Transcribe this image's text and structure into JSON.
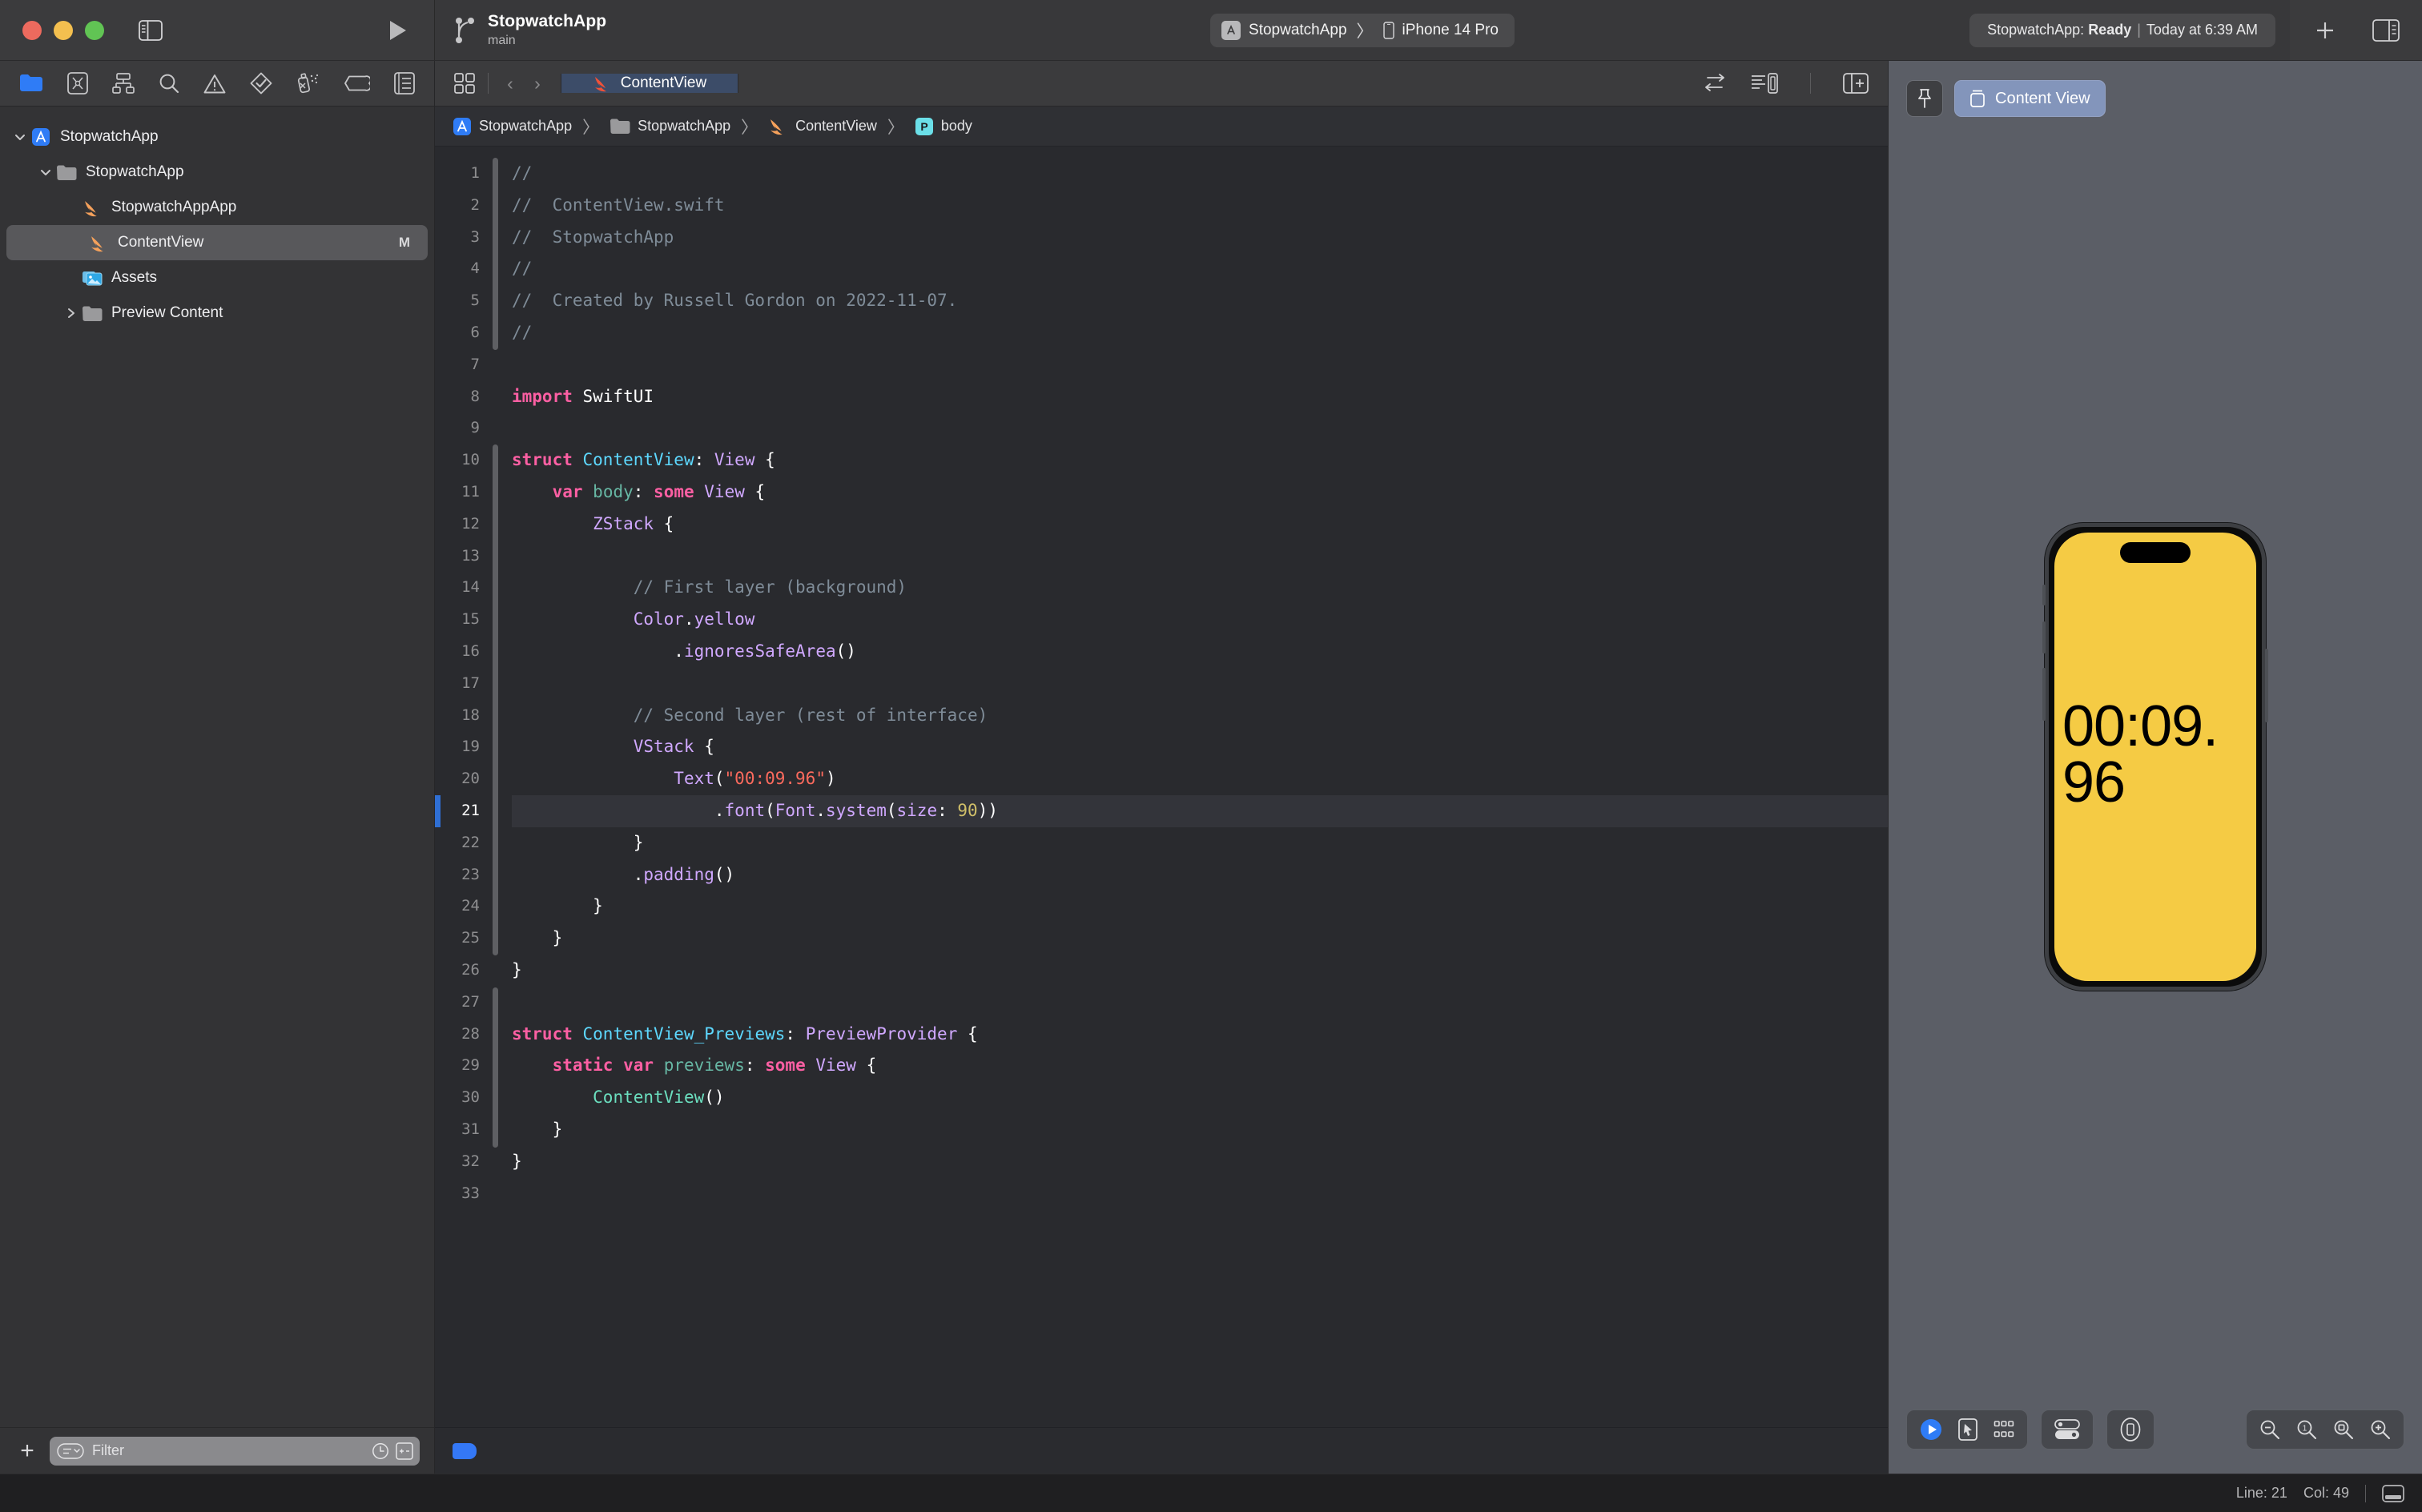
{
  "window": {
    "traffic_lights": [
      "close",
      "minimize",
      "zoom"
    ],
    "sidebar_toggle_icon": "sidebar-left-icon",
    "run_icon": "play-icon",
    "add_icon": "plus-icon",
    "inspector_toggle_icon": "sidebar-right-icon"
  },
  "project": {
    "name": "StopwatchApp",
    "branch": "main",
    "branch_icon": "git-branch-icon"
  },
  "scheme": {
    "app_icon": "appstore-icon",
    "scheme_name": "StopwatchApp",
    "separator": "〉",
    "device_icon": "iphone-icon",
    "destination": "iPhone 14 Pro"
  },
  "activity": {
    "prefix": "StopwatchApp:",
    "state": "Ready",
    "divider": "|",
    "time": "Today at 6:39 AM"
  },
  "navigator": {
    "tabs": [
      {
        "name": "project-navigator",
        "icon": "folder-icon",
        "active": true
      },
      {
        "name": "source-control-navigator",
        "icon": "source-control-icon",
        "active": false
      },
      {
        "name": "symbol-navigator",
        "icon": "hierarchy-icon",
        "active": false
      },
      {
        "name": "find-navigator",
        "icon": "search-icon",
        "active": false
      },
      {
        "name": "issue-navigator",
        "icon": "warning-triangle-icon",
        "active": false
      },
      {
        "name": "test-navigator",
        "icon": "diamond-check-icon",
        "active": false
      },
      {
        "name": "debug-navigator",
        "icon": "spray-icon",
        "active": false
      },
      {
        "name": "breakpoint-navigator",
        "icon": "tag-icon",
        "active": false
      },
      {
        "name": "report-navigator",
        "icon": "list-icon",
        "active": false
      }
    ],
    "tree": [
      {
        "label": "StopwatchApp",
        "icon": "appstore-icon",
        "depth": 0,
        "disclosure": "open",
        "selected": false,
        "badge": ""
      },
      {
        "label": "StopwatchApp",
        "icon": "folder-icon",
        "depth": 1,
        "disclosure": "open",
        "selected": false,
        "badge": ""
      },
      {
        "label": "StopwatchAppApp",
        "icon": "swift-icon",
        "depth": 2,
        "disclosure": "none",
        "selected": false,
        "badge": ""
      },
      {
        "label": "ContentView",
        "icon": "swift-icon",
        "depth": 2,
        "disclosure": "none",
        "selected": true,
        "badge": "M"
      },
      {
        "label": "Assets",
        "icon": "assets-icon",
        "depth": 2,
        "disclosure": "none",
        "selected": false,
        "badge": ""
      },
      {
        "label": "Preview Content",
        "icon": "folder-icon",
        "depth": 2,
        "disclosure": "closed",
        "selected": false,
        "badge": ""
      }
    ],
    "filter": {
      "placeholder": "Filter",
      "add_label": "+",
      "filter_icon": "filter-lines-icon",
      "recent_icon": "clock-icon",
      "source-control-icon": "plus-minus-icon"
    }
  },
  "editor": {
    "jumpbar_icon": "grid-squares-icon",
    "back_arrow": "‹",
    "forward_arrow": "›",
    "tab": {
      "label": "ContentView",
      "icon": "swift-icon"
    },
    "right_icons": [
      "adjust-editor-icon",
      "minimap-icon",
      "add-editor-icon"
    ],
    "breadcrumb": [
      {
        "label": "StopwatchApp",
        "icon": "appstore-icon"
      },
      {
        "label": "StopwatchApp",
        "icon": "folder-icon"
      },
      {
        "label": "ContentView",
        "icon": "swift-icon"
      },
      {
        "label": "body",
        "icon": "property-badge"
      }
    ],
    "breadcrumb_separator": "〉",
    "highlighted_line": 21,
    "first_line": 1,
    "last_line": 33,
    "code_lines": [
      {
        "n": 1,
        "tokens": [
          {
            "t": "//",
            "c": "cmt"
          }
        ]
      },
      {
        "n": 2,
        "tokens": [
          {
            "t": "//  ContentView.swift",
            "c": "cmt"
          }
        ]
      },
      {
        "n": 3,
        "tokens": [
          {
            "t": "//  StopwatchApp",
            "c": "cmt"
          }
        ]
      },
      {
        "n": 4,
        "tokens": [
          {
            "t": "//",
            "c": "cmt"
          }
        ]
      },
      {
        "n": 5,
        "tokens": [
          {
            "t": "//  Created by Russell Gordon on 2022-11-07.",
            "c": "cmt"
          }
        ]
      },
      {
        "n": 6,
        "tokens": [
          {
            "t": "//",
            "c": "cmt"
          }
        ]
      },
      {
        "n": 7,
        "tokens": []
      },
      {
        "n": 8,
        "tokens": [
          {
            "t": "import",
            "c": "kw"
          },
          {
            "t": " SwiftUI",
            "c": "plain"
          }
        ]
      },
      {
        "n": 9,
        "tokens": []
      },
      {
        "n": 10,
        "tokens": [
          {
            "t": "struct",
            "c": "kw"
          },
          {
            "t": " ",
            "c": "plain"
          },
          {
            "t": "ContentView",
            "c": "typ"
          },
          {
            "t": ": ",
            "c": "plain"
          },
          {
            "t": "View",
            "c": "proto"
          },
          {
            "t": " {",
            "c": "plain"
          }
        ]
      },
      {
        "n": 11,
        "tokens": [
          {
            "t": "    ",
            "c": "plain"
          },
          {
            "t": "var",
            "c": "kw"
          },
          {
            "t": " ",
            "c": "plain"
          },
          {
            "t": "body",
            "c": "prop"
          },
          {
            "t": ": ",
            "c": "plain"
          },
          {
            "t": "some",
            "c": "kw"
          },
          {
            "t": " ",
            "c": "plain"
          },
          {
            "t": "View",
            "c": "proto"
          },
          {
            "t": " {",
            "c": "plain"
          }
        ]
      },
      {
        "n": 12,
        "tokens": [
          {
            "t": "        ",
            "c": "plain"
          },
          {
            "t": "ZStack",
            "c": "proto"
          },
          {
            "t": " {",
            "c": "plain"
          }
        ]
      },
      {
        "n": 13,
        "tokens": []
      },
      {
        "n": 14,
        "tokens": [
          {
            "t": "            // First layer (background)",
            "c": "cmt"
          }
        ]
      },
      {
        "n": 15,
        "tokens": [
          {
            "t": "            ",
            "c": "plain"
          },
          {
            "t": "Color",
            "c": "proto"
          },
          {
            "t": ".",
            "c": "plain"
          },
          {
            "t": "yellow",
            "c": "meth"
          }
        ]
      },
      {
        "n": 16,
        "tokens": [
          {
            "t": "                ",
            "c": "plain"
          },
          {
            "t": ".",
            "c": "plain"
          },
          {
            "t": "ignoresSafeArea",
            "c": "meth"
          },
          {
            "t": "()",
            "c": "plain"
          }
        ]
      },
      {
        "n": 17,
        "tokens": []
      },
      {
        "n": 18,
        "tokens": [
          {
            "t": "            // Second layer (rest of interface)",
            "c": "cmt"
          }
        ]
      },
      {
        "n": 19,
        "tokens": [
          {
            "t": "            ",
            "c": "plain"
          },
          {
            "t": "VStack",
            "c": "proto"
          },
          {
            "t": " {",
            "c": "plain"
          }
        ]
      },
      {
        "n": 20,
        "tokens": [
          {
            "t": "                ",
            "c": "plain"
          },
          {
            "t": "Text",
            "c": "proto"
          },
          {
            "t": "(",
            "c": "plain"
          },
          {
            "t": "\"00:09.96\"",
            "c": "str"
          },
          {
            "t": ")",
            "c": "plain"
          }
        ]
      },
      {
        "n": 21,
        "tokens": [
          {
            "t": "                    ",
            "c": "plain"
          },
          {
            "t": ".",
            "c": "plain"
          },
          {
            "t": "font",
            "c": "meth"
          },
          {
            "t": "(",
            "c": "plain"
          },
          {
            "t": "Font",
            "c": "proto"
          },
          {
            "t": ".",
            "c": "plain"
          },
          {
            "t": "system",
            "c": "meth"
          },
          {
            "t": "(",
            "c": "plain"
          },
          {
            "t": "size",
            "c": "meth"
          },
          {
            "t": ": ",
            "c": "plain"
          },
          {
            "t": "90",
            "c": "num"
          },
          {
            "t": "))",
            "c": "plain"
          }
        ]
      },
      {
        "n": 22,
        "tokens": [
          {
            "t": "            }",
            "c": "plain"
          }
        ]
      },
      {
        "n": 23,
        "tokens": [
          {
            "t": "            ",
            "c": "plain"
          },
          {
            "t": ".",
            "c": "plain"
          },
          {
            "t": "padding",
            "c": "meth"
          },
          {
            "t": "()",
            "c": "plain"
          }
        ]
      },
      {
        "n": 24,
        "tokens": [
          {
            "t": "        }",
            "c": "plain"
          }
        ]
      },
      {
        "n": 25,
        "tokens": [
          {
            "t": "    }",
            "c": "plain"
          }
        ]
      },
      {
        "n": 26,
        "tokens": [
          {
            "t": "}",
            "c": "plain"
          }
        ]
      },
      {
        "n": 27,
        "tokens": []
      },
      {
        "n": 28,
        "tokens": [
          {
            "t": "struct",
            "c": "kw"
          },
          {
            "t": " ",
            "c": "plain"
          },
          {
            "t": "ContentView_Previews",
            "c": "typ"
          },
          {
            "t": ": ",
            "c": "plain"
          },
          {
            "t": "PreviewProvider",
            "c": "proto"
          },
          {
            "t": " {",
            "c": "plain"
          }
        ]
      },
      {
        "n": 29,
        "tokens": [
          {
            "t": "    ",
            "c": "plain"
          },
          {
            "t": "static",
            "c": "kw"
          },
          {
            "t": " ",
            "c": "plain"
          },
          {
            "t": "var",
            "c": "kw"
          },
          {
            "t": " ",
            "c": "plain"
          },
          {
            "t": "previews",
            "c": "prop"
          },
          {
            "t": ": ",
            "c": "plain"
          },
          {
            "t": "some",
            "c": "kw"
          },
          {
            "t": " ",
            "c": "plain"
          },
          {
            "t": "View",
            "c": "proto"
          },
          {
            "t": " {",
            "c": "plain"
          }
        ]
      },
      {
        "n": 30,
        "tokens": [
          {
            "t": "        ",
            "c": "plain"
          },
          {
            "t": "ContentView",
            "c": "teal"
          },
          {
            "t": "()",
            "c": "plain"
          }
        ]
      },
      {
        "n": 31,
        "tokens": [
          {
            "t": "    }",
            "c": "plain"
          }
        ]
      },
      {
        "n": 32,
        "tokens": [
          {
            "t": "}",
            "c": "plain"
          }
        ]
      },
      {
        "n": 33,
        "tokens": []
      }
    ]
  },
  "preview": {
    "pin_icon": "pin-icon",
    "canvas_pill": {
      "label": "Content View",
      "icon": "preview-cube-icon"
    },
    "device": "iPhone 14 Pro",
    "screen_background_color": "#F5CB44",
    "screen_text": "00:09.96",
    "screen_text_color": "#000000",
    "screen_font_size": 90,
    "controls": {
      "live_icon": "play-circle-icon",
      "select_icon": "cursor-frame-icon",
      "variants_icon": "grid-dots-icon",
      "device_settings_icon": "toggles-icon",
      "orientation_icon": "device-rotate-icon",
      "zoom_out_icon": "zoom-out-icon",
      "zoom_100_icon": "zoom-100-icon",
      "zoom_fit_icon": "zoom-fit-icon",
      "zoom_in_icon": "zoom-in-icon"
    }
  },
  "status_bar": {
    "line_label": "Line: 21",
    "col_label": "Col: 49",
    "debug_toggle_icon": "debug-area-icon"
  }
}
